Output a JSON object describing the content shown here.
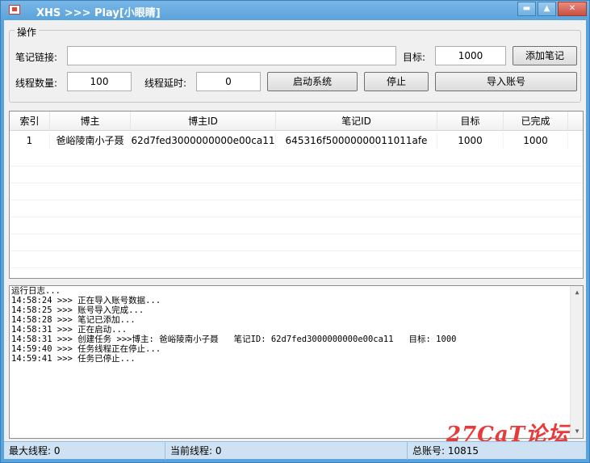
{
  "window": {
    "title": "XHS >>> Play[小眼睛]",
    "controls": [
      "▬",
      "▲",
      "✕"
    ]
  },
  "operations": {
    "group_title": "操作",
    "note_link_label": "笔记链接:",
    "note_link_value": "",
    "target_label": "目标:",
    "target_value": "1000",
    "add_note_button": "添加笔记",
    "thread_count_label": "线程数量:",
    "thread_count_value": "100",
    "thread_delay_label": "线程延时:",
    "thread_delay_value": "0",
    "start_button": "启动系统",
    "stop_button": "停止",
    "import_button": "导入账号"
  },
  "table": {
    "columns": [
      "索引",
      "博主",
      "博主ID",
      "笔记ID",
      "目标",
      "已完成"
    ],
    "rows": [
      [
        "1",
        "爸峪陵南小子聂",
        "62d7fed3000000000e00ca11",
        "645316f50000000011011afe",
        "1000",
        "1000"
      ]
    ]
  },
  "log": {
    "lines": [
      "运行日志...",
      "14:58:24 >>> 正在导入账号数据...",
      "14:58:25 >>> 账号导入完成...",
      "14:58:28 >>> 笔记已添加...",
      "14:58:31 >>> 正在启动...",
      "14:58:31 >>> 创建任务 >>>博主: 爸峪陵南小子聂   笔记ID: 62d7fed3000000000e00ca11   目标: 1000",
      "14:59:40 >>> 任务线程正在停止...",
      "14:59:41 >>> 任务已停止..."
    ]
  },
  "watermark": "27CaT论坛",
  "status": {
    "max_threads": "最大线程: 0",
    "current_threads": "当前线程: 0",
    "total_accounts": "总账号: 10815"
  }
}
